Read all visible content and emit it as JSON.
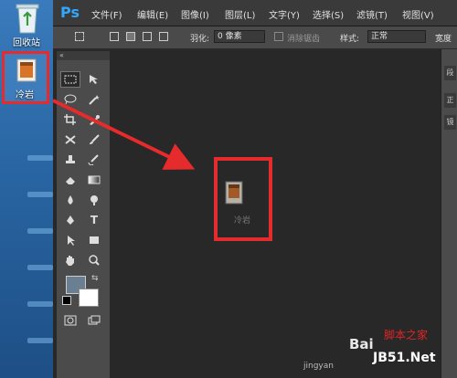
{
  "desktop": {
    "recycle_bin_label": "回收站",
    "cold_icon_label": "冷岩"
  },
  "photoshop": {
    "logo": "Ps",
    "menu": [
      "文件(F)",
      "编辑(E)",
      "图像(I)",
      "图层(L)",
      "文字(Y)",
      "选择(S)",
      "滤镜(T)",
      "视图(V)"
    ],
    "options": {
      "feather_label": "羽化:",
      "feather_value": "0 像素",
      "antialias_label": "消除锯齿",
      "style_label": "样式:",
      "style_value": "正常",
      "width_label": "宽度"
    },
    "toolpanel_collapse": "«",
    "right_dock": [
      "段",
      "正",
      "镜"
    ],
    "dragged_file_label": "冷岩"
  },
  "watermark": {
    "baidu": "Bai",
    "jingyan": "jingyan",
    "jb51_top": "脚本之家",
    "jb51": "JB51.Net"
  },
  "colors": {
    "highlight": "#e52b2b",
    "ps_blue": "#31a8ff"
  }
}
